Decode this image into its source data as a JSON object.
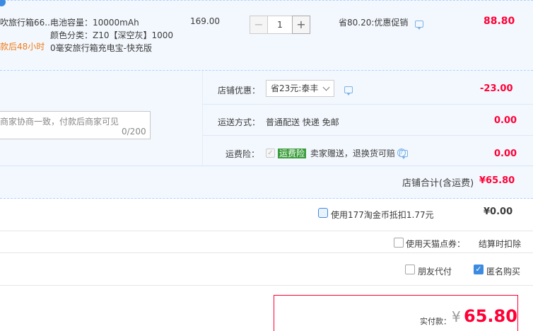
{
  "item": {
    "title": "吹旅行箱66...",
    "delivery_note": "款后48小时",
    "spec_capacity": "电池容量：10000mAh",
    "spec_color": "颜色分类：Z10【深空灰】1000",
    "spec_desc": "0毫安旅行箱充电宝-快充版",
    "unit_price": "169.00",
    "quantity": "1",
    "minus": "−",
    "plus": "+",
    "promotion": "省80.20:优惠促销",
    "subtotal": "88.80"
  },
  "shop": {
    "message_placeholder": "商家协商一致，付款后商家可见",
    "message_counter": "0/200",
    "discount_label": "店铺优惠：",
    "discount_selected": "省23元:泰丰",
    "discount_amount": "-23.00",
    "shipping_label": "运送方式：",
    "shipping_value": "普通配送 快递 免邮",
    "shipping_amount": "0.00",
    "insurance_label": "运费险：",
    "insurance_badge": "运费险",
    "insurance_text": "卖家赠送，退换货可赔",
    "insurance_amount": "0.00",
    "total_label": "店铺合计(含运费)",
    "total_value": "¥65.80"
  },
  "options": {
    "coin_label": "使用177淘金币抵扣1.77元",
    "coin_amount": "¥0.00",
    "tmall_points_label": "使用天猫点券：",
    "tmall_points_value": "结算时扣除",
    "friend_pay_label": "朋友代付",
    "anonymous_label": "匿名购买",
    "check_mark": "✓",
    "help_glyph": "?"
  },
  "payment": {
    "label": "实付款：",
    "currency": "¥",
    "amount": "65.80"
  },
  "colors": {
    "accent_red": "#ff0036",
    "accent_blue": "#3c8be0",
    "bg_light_blue": "#f3f8fe"
  }
}
